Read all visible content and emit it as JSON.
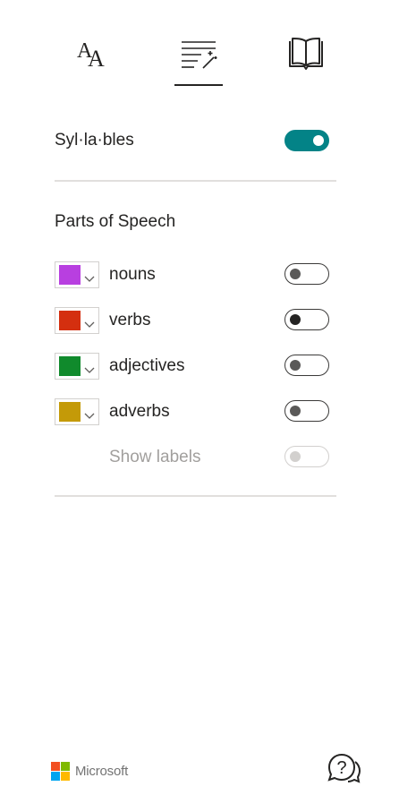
{
  "tabs": [
    {
      "icon": "text-preferences-icon",
      "active": false
    },
    {
      "icon": "grammar-options-icon",
      "active": true
    },
    {
      "icon": "reading-preferences-icon",
      "active": false
    }
  ],
  "syllables": {
    "label": "Syl·la·bles",
    "toggle_on": true
  },
  "parts_of_speech": {
    "heading": "Parts of Speech",
    "items": [
      {
        "label": "nouns",
        "color": "#b83fe0",
        "toggle_on": false
      },
      {
        "label": "verbs",
        "color": "#d42f0f",
        "toggle_on": false
      },
      {
        "label": "adjectives",
        "color": "#108a2c",
        "toggle_on": false
      },
      {
        "label": "adverbs",
        "color": "#c49a08",
        "toggle_on": false
      }
    ],
    "show_labels": {
      "label": "Show labels",
      "toggle_on": false,
      "disabled": true
    }
  },
  "footer": {
    "brand": "Microsoft",
    "help_icon": "help-icon"
  },
  "colors": {
    "accent": "#038387",
    "text": "#252423",
    "disabled": "#a19f9d"
  }
}
